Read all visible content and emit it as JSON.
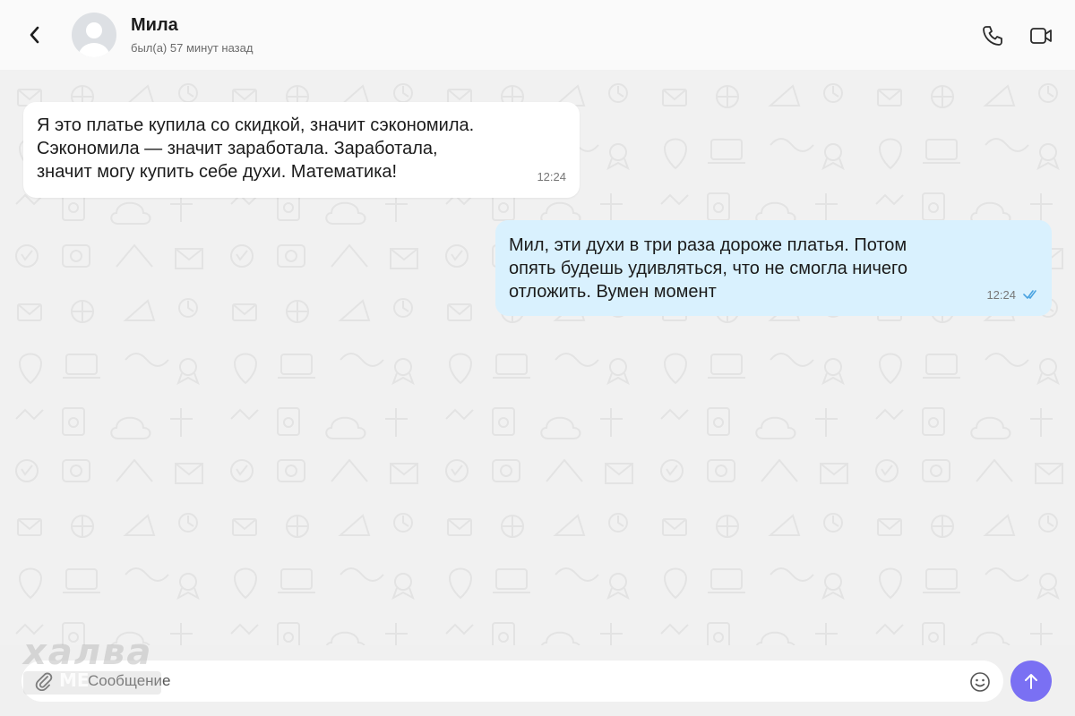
{
  "header": {
    "contact_name": "Мила",
    "contact_status": "был(а) 57 минут назад"
  },
  "messages": [
    {
      "direction": "incoming",
      "text": "Я это платье купила со скидкой, значит сэкономила.\nСэкономила — значит заработала. Заработала,\nзначит могу купить себе духи. Математика!",
      "time": "12:24"
    },
    {
      "direction": "outgoing",
      "text": "Мил, эти духи в три раза дороже платья. Потом\nопять будешь удивляться, что не смогла ничего\nотложить. Вумен момент",
      "time": "12:24",
      "status": "read"
    }
  ],
  "composer": {
    "placeholder": "Сообщение",
    "value": ""
  },
  "watermark": {
    "main": "халва",
    "sub": "МЕ"
  },
  "icons": {
    "back": "chevron-left-icon",
    "call": "phone-icon",
    "video": "video-camera-icon",
    "attach": "paperclip-icon",
    "emoji": "smiley-icon",
    "send": "arrow-up-icon",
    "status": "check-icon"
  },
  "colors": {
    "outgoing_bubble": "#d9f1fe",
    "incoming_bubble": "#ffffff",
    "send_button": "#7a70f3",
    "read_check": "#4aa3e0"
  }
}
